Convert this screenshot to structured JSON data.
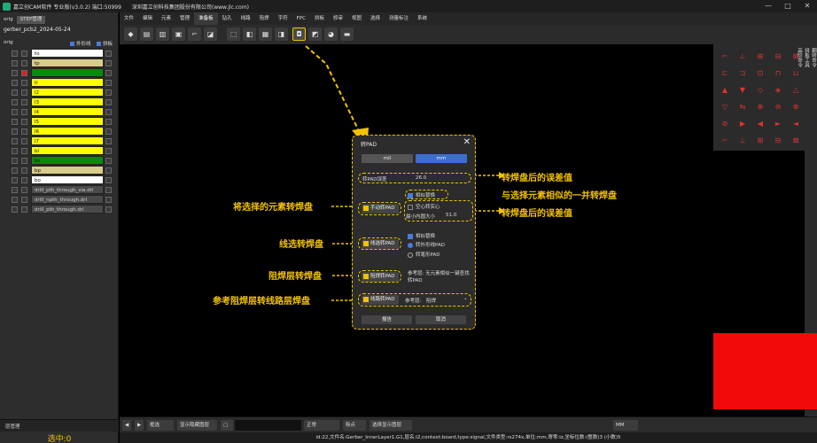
{
  "titlebar": {
    "app_title": "嘉立创CAM软件 专业版(v3.0.2) 端口:50999",
    "company": "深圳嘉立创科技集团股份有限公司(www.jlc.com)"
  },
  "left_panel": {
    "tabs": [
      "orig",
      "STEP管理"
    ],
    "project": "gerber_pcb2_2024-05-24",
    "header": {
      "name": "orig",
      "outline": "外形线",
      "panel": "拼板"
    },
    "layers": [
      {
        "name": "to",
        "color": "#ffffff"
      },
      {
        "name": "tp",
        "color": "#d8cc8a"
      },
      {
        "name": "",
        "color": "#0a8a0a"
      },
      {
        "name": "tl",
        "color": "#ffff00"
      },
      {
        "name": "l2",
        "color": "#ffff00"
      },
      {
        "name": "l3",
        "color": "#ffff00"
      },
      {
        "name": "l4",
        "color": "#ffff00"
      },
      {
        "name": "l5",
        "color": "#ffff00"
      },
      {
        "name": "l6",
        "color": "#ffff00"
      },
      {
        "name": "l7",
        "color": "#ffff00"
      },
      {
        "name": "bl",
        "color": "#ffff00"
      },
      {
        "name": "bs",
        "color": "#0a8a0a"
      },
      {
        "name": "bp",
        "color": "#d8cc8a"
      },
      {
        "name": "bo",
        "color": "#ffffff"
      },
      {
        "name": "drill_pth_through_via.drl",
        "color": "#4a4a4a"
      },
      {
        "name": "drill_npth_through.drl",
        "color": "#4a4a4a"
      },
      {
        "name": "drill_pth_through.drl",
        "color": "#4a4a4a"
      }
    ],
    "bottom_button": "层管理",
    "selected": "选中:0"
  },
  "menubar": [
    "文件",
    "编辑",
    "元素",
    "管理",
    "准备板",
    "钻孔",
    "线路",
    "阻焊",
    "字符",
    "FPC",
    "拼板",
    "修审",
    "视图",
    "选择",
    "测量标注",
    "系统"
  ],
  "active_menu": "准备板",
  "dialog": {
    "title": "转PAD",
    "units": [
      "mil",
      "mm"
    ],
    "active_unit": "mm",
    "tolerance_label": "转PAD误差",
    "tolerance_value": "26.0",
    "similar_label": "相似替换",
    "selected_btn": "手动转PAD",
    "hollow_label": "空心转实心",
    "min_ring_label": "最小内圆大小",
    "min_ring_value": "51.0",
    "line_btn": "线选转PAD",
    "similar2_label": "相似替换",
    "radio1": "转外形线PAD",
    "radio2": "转笔形PAD",
    "mask_btn": "阻焊转PAD",
    "ref_text": "参考层: 无元素相似一键查找转PAD",
    "ref_btn": "线路转PAD",
    "ref_layer_label": "参考层:",
    "ref_layer_value": "阻焊",
    "ok": "报告",
    "cancel": "取消"
  },
  "annotations": {
    "tol1": "转焊盘后的误差值",
    "similar": "与选择元素相似的一并转焊盘",
    "tol2": "转焊盘后的误差值",
    "selected_to_pad": "将选择的元素转焊盘",
    "line_to_pad": "线选转焊盘",
    "mask_to_pad": "阻焊层转焊盘",
    "ref_to_pad": "参考阻焊层转线路层焊盘"
  },
  "right_panel": {
    "side_tabs": [
      "翻转命令",
      "拼板工具",
      "高阶命令"
    ]
  },
  "statusbar": {
    "mode": "框选",
    "show_btn": "显示隐藏图层",
    "mode2": "正常",
    "pick": "吸点",
    "all_layers": "选择显示图层",
    "unit": "MM"
  },
  "infobar": "id:22,文件名:Gerber_InnerLayer1.G1,层名:l2,context:board,type:signal,文件类型:rs274x,单位:mm,寄零:lz,坐标位数:(整数)3 (小数)5",
  "colors": {
    "accent": "#f2c200",
    "mm_active": "#3a6fd0",
    "red_block": "#f20a0a"
  },
  "icons": [
    "window-minimize-icon",
    "window-maximize-icon",
    "window-close-icon",
    "arrow-left-icon",
    "arrow-right-icon",
    "close-icon"
  ]
}
